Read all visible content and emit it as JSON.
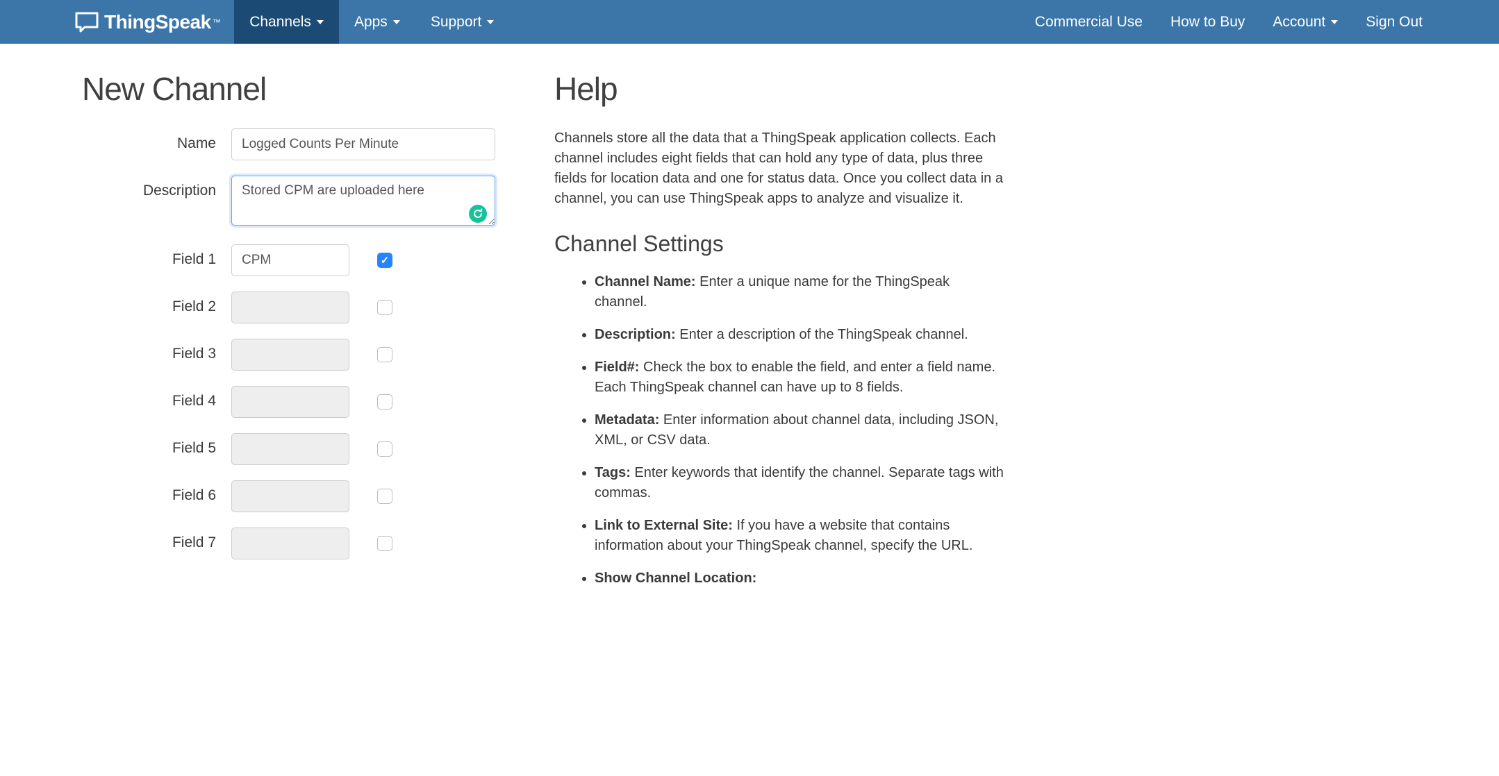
{
  "brand": "ThingSpeak",
  "nav": {
    "left": [
      {
        "label": "Channels",
        "dropdown": true,
        "active": true
      },
      {
        "label": "Apps",
        "dropdown": true,
        "active": false
      },
      {
        "label": "Support",
        "dropdown": true,
        "active": false
      }
    ],
    "right": [
      {
        "label": "Commercial Use",
        "dropdown": false
      },
      {
        "label": "How to Buy",
        "dropdown": false
      },
      {
        "label": "Account",
        "dropdown": true
      },
      {
        "label": "Sign Out",
        "dropdown": false
      }
    ]
  },
  "page_title": "New Channel",
  "form": {
    "name_label": "Name",
    "name_value": "Logged Counts Per Minute",
    "desc_label": "Description",
    "desc_value": "Stored CPM are uploaded here",
    "fields": [
      {
        "label": "Field 1",
        "value": "CPM",
        "checked": true,
        "enabled": true
      },
      {
        "label": "Field 2",
        "value": "",
        "checked": false,
        "enabled": false
      },
      {
        "label": "Field 3",
        "value": "",
        "checked": false,
        "enabled": false
      },
      {
        "label": "Field 4",
        "value": "",
        "checked": false,
        "enabled": false
      },
      {
        "label": "Field 5",
        "value": "",
        "checked": false,
        "enabled": false
      },
      {
        "label": "Field 6",
        "value": "",
        "checked": false,
        "enabled": false
      },
      {
        "label": "Field 7",
        "value": "",
        "checked": false,
        "enabled": false
      }
    ]
  },
  "help": {
    "title": "Help",
    "intro": "Channels store all the data that a ThingSpeak application collects. Each channel includes eight fields that can hold any type of data, plus three fields for location data and one for status data. Once you collect data in a channel, you can use ThingSpeak apps to analyze and visualize it.",
    "subtitle": "Channel Settings",
    "items": [
      {
        "term": "Channel Name:",
        "text": " Enter a unique name for the ThingSpeak channel."
      },
      {
        "term": "Description:",
        "text": " Enter a description of the ThingSpeak channel."
      },
      {
        "term": "Field#:",
        "text": " Check the box to enable the field, and enter a field name. Each ThingSpeak channel can have up to 8 fields."
      },
      {
        "term": "Metadata:",
        "text": " Enter information about channel data, including JSON, XML, or CSV data."
      },
      {
        "term": "Tags:",
        "text": " Enter keywords that identify the channel. Separate tags with commas."
      },
      {
        "term": "Link to External Site:",
        "text": " If you have a website that contains information about your ThingSpeak channel, specify the URL."
      },
      {
        "term": "Show Channel Location:",
        "text": ""
      }
    ]
  }
}
